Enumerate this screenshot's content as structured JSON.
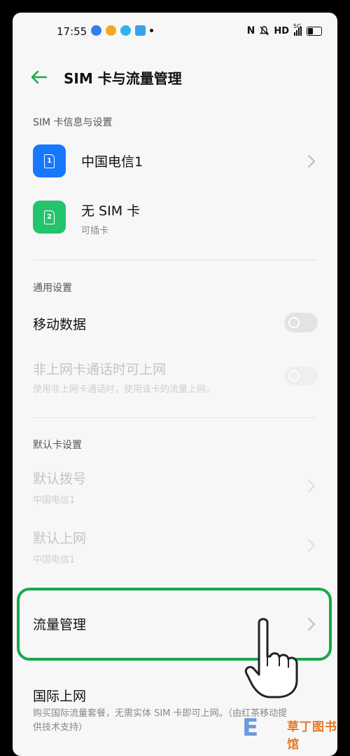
{
  "status_bar": {
    "time": "17:55",
    "network": "HD",
    "signal_label": "5G",
    "battery_level": 0.45
  },
  "header": {
    "title": "SIM 卡与流量管理"
  },
  "sim_section": {
    "header": "SIM 卡信息与设置",
    "cards": [
      {
        "slot": "1",
        "name": "中国电信1",
        "sub": "",
        "color": "#1677ff"
      },
      {
        "slot": "2",
        "name": "无 SIM 卡",
        "sub": "可插卡",
        "color": "#25c46c"
      }
    ]
  },
  "general_section": {
    "header": "通用设置",
    "mobile_data": {
      "label": "移动数据",
      "enabled": false
    },
    "call_data": {
      "label": "非上网卡通话时可上网",
      "sub": "使用非上网卡通话时，使用该卡的流量上网。",
      "enabled": false
    }
  },
  "default_section": {
    "header": "默认卡设置",
    "default_call": {
      "label": "默认拨号",
      "value": "中国电信1"
    },
    "default_data": {
      "label": "默认上网",
      "value": "中国电信1"
    }
  },
  "traffic": {
    "label": "流量管理"
  },
  "roaming": {
    "label": "国际上网",
    "sub": "购买国际流量套餐，无需实体 SIM 卡即可上网。（由红茶移动提供技术支持）"
  },
  "watermark": {
    "text": "草丁图书馆"
  },
  "colors": {
    "accent": "#17a94d",
    "sim1": "#1677ff",
    "sim2": "#25c46c"
  }
}
